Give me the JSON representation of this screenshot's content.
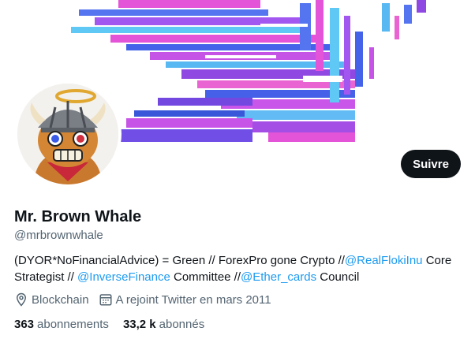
{
  "profile": {
    "display_name": "Mr. Brown Whale",
    "handle": "@mrbrownwhale",
    "follow_label": "Suivre",
    "bio": {
      "t1": "(DYOR*NoFinancialAdvice) = Green // ForexPro gone Crypto //",
      "m1": "@RealFlokiInu",
      "t2": " Core Strategist //",
      "m2": "@InverseFinance",
      "t3": " Committee //",
      "m3": "@Ether_cards",
      "t4": " Council"
    },
    "location": "Blockchain",
    "joined": "A rejoint Twitter en mars 2011",
    "following_count": "363",
    "following_label": "abonnements",
    "followers_count": "33,2 k",
    "followers_label": "abonnés"
  },
  "icons": {
    "location": "location-pin-icon",
    "calendar": "calendar-icon"
  },
  "colors": {
    "accent": "#1d9bf0",
    "text": "#0f1419",
    "muted": "#536471",
    "button_bg": "#0f1419"
  }
}
